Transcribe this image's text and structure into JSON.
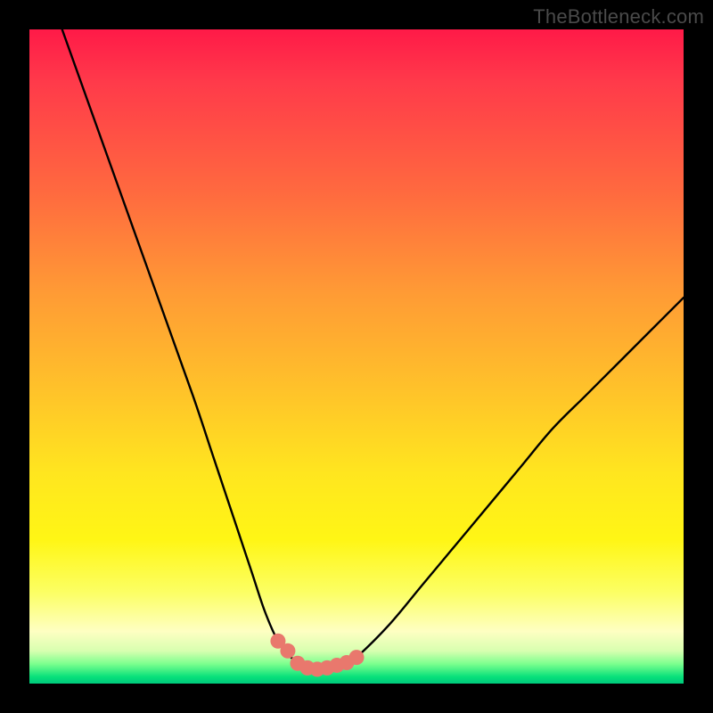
{
  "watermark": "TheBottleneck.com",
  "colors": {
    "background": "#000000",
    "gradient_top": "#ff1a48",
    "gradient_mid1": "#ff9a35",
    "gradient_mid2": "#ffe61f",
    "gradient_bottom": "#00c97c",
    "curve_stroke": "#000000",
    "marker_fill": "#e9786d"
  },
  "chart_data": {
    "type": "line",
    "title": "",
    "xlabel": "",
    "ylabel": "",
    "xlim": [
      0,
      100
    ],
    "ylim": [
      0,
      100
    ],
    "grid": false,
    "series": [
      {
        "name": "bottleneck-curve",
        "x": [
          5,
          10,
          15,
          20,
          25,
          28,
          30,
          32,
          34,
          36,
          38,
          40,
          42,
          44,
          46,
          48,
          50,
          55,
          60,
          65,
          70,
          75,
          80,
          85,
          90,
          95,
          100
        ],
        "values": [
          100,
          86,
          72,
          58,
          44,
          35,
          29,
          23,
          17,
          11,
          6.5,
          4.0,
          2.6,
          2.2,
          2.2,
          2.6,
          4.0,
          9.0,
          15,
          21,
          27,
          33,
          39,
          44,
          49,
          54,
          59
        ]
      }
    ],
    "markers": {
      "name": "highlighted-range",
      "x": [
        38,
        39.5,
        41,
        42.5,
        44,
        45.5,
        47,
        48.5,
        50
      ],
      "values": [
        6.5,
        5.0,
        3.1,
        2.4,
        2.2,
        2.4,
        2.8,
        3.2,
        4.0
      ]
    }
  }
}
